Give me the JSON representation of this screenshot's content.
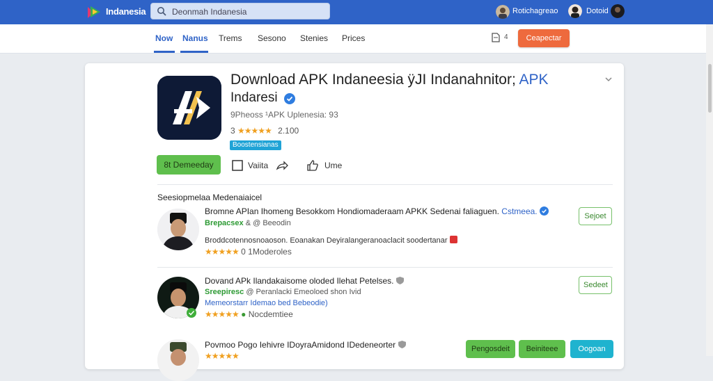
{
  "topbar": {
    "brand": "Indanesia",
    "search_value": "Deonmah Indanesia",
    "user_name": "Rotichagreao",
    "user2_name": "Dotoid"
  },
  "nav": {
    "items": [
      "Now",
      "Nanus",
      "Trems",
      "Sesono",
      "Stenies",
      "Prices"
    ],
    "active": "Now",
    "count": "4",
    "cta_label": "Ceapectar"
  },
  "app": {
    "title_part1": "Download APK Indaneesia",
    "title_part2": "ÿJI Indanahnitor",
    "title_blue": "APK",
    "title_line2": "Indaresi",
    "meta": "9Pheoss ¹APK Uplenesia: 93",
    "rating_prefix": "3",
    "stars": "★★★★★",
    "rating_count": "2.100",
    "badge": "Boostensianas",
    "install_label": "8t Demeeday",
    "action_1": "Vaiita",
    "action_2": "Ume"
  },
  "reviews": {
    "section_title": "Seesiopmelaa Medenaiaicel",
    "items": [
      {
        "title": "Bromne APIan Ihomeng Besokkom Hondiomaderaam APKK Sedenai faliaguen.",
        "title_blue": "Cstmeea.",
        "sub_green": "Brepacsex",
        "sub": "& @ Beeodin",
        "line": "Broddcotennosnoaoson. Eoanakan Deyiralangeranoaclacit soodertanar",
        "stars": "★★★★★",
        "stars_text": "0  1Moderoles",
        "button": "Sejoet"
      },
      {
        "title": "Dovand APk Ilandakaisome oloded Ilehat Petelses.",
        "title_blue": "",
        "sub_green": "Sreepiresc",
        "sub": "@ Peranlacki  Emeoloed shon  Ivid",
        "line": "Memeorstarr Idemao bed Bebeodie)",
        "stars": "★★★★★",
        "stars_text": "Nocdemtiee",
        "button": "Sedeet"
      },
      {
        "title": "Povmoo Pogo Iehivre IDoyraAmidond IDedeneorter",
        "title_blue": "",
        "sub_green": "",
        "sub": "",
        "line": "",
        "stars": "★★★★★",
        "stars_text": "",
        "buttons": [
          "Pengosdeit",
          "Beiniteee",
          "Oogoan"
        ]
      }
    ]
  },
  "colors": {
    "topbar": "#2f63c7",
    "accent_orange": "#ee6a3d",
    "install_green": "#5fbf4d",
    "star_gold": "#f0a020",
    "badge_blue": "#1fa3d6"
  }
}
